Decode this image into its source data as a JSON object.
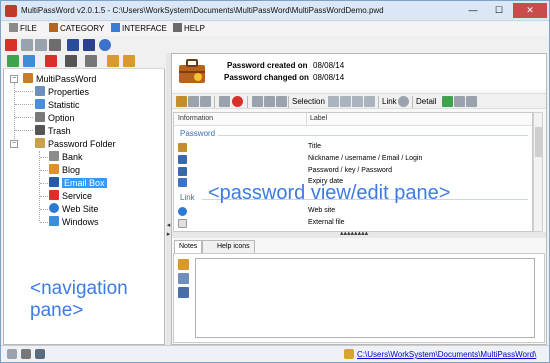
{
  "window": {
    "title": "MultiPassWord v2.0.1.5 - C:\\Users\\WorkSystem\\Documents\\MultiPassWord\\MultiPassWordDemo.pwd",
    "minimize": "—",
    "maximize": "☐",
    "close": "✕"
  },
  "menu": [
    "FILE",
    "CATEGORY",
    "INTERFACE",
    "HELP"
  ],
  "tree": {
    "root": "MultiPassWord",
    "items": [
      "Properties",
      "Statistic",
      "Option",
      "Trash",
      "Password Folder"
    ],
    "folders": [
      "Bank",
      "Blog",
      "Email Box",
      "Service",
      "Web Site",
      "Windows"
    ]
  },
  "info": {
    "created_label": "Password created on",
    "created_value": "08/08/14",
    "changed_label": "Password changed on",
    "changed_value": "08/08/14"
  },
  "pw_toolbar": {
    "selection": "Selection",
    "link": "Link",
    "detail": "Detail"
  },
  "grid": {
    "columns": [
      "Information",
      "Label"
    ],
    "group_password": "Password",
    "password_rows": [
      "Title",
      "Nickname / username / Email / Login",
      "Password / key / Password",
      "Expiry date"
    ],
    "group_link": "Link",
    "link_rows": [
      "Web site",
      "External file"
    ]
  },
  "tabs": [
    "Notes",
    "Help icons"
  ],
  "status": {
    "path": "C:\\Users\\WorkSystem\\Documents\\MultiPassWord\\"
  },
  "annotations": {
    "password_pane": "<password view/edit pane>",
    "navigation_line1": "<navigation",
    "navigation_line2": "pane>"
  },
  "colors": {
    "annotation": "#3d7be3",
    "selection": "#3399ff",
    "group_text": "#3a6fb5"
  }
}
